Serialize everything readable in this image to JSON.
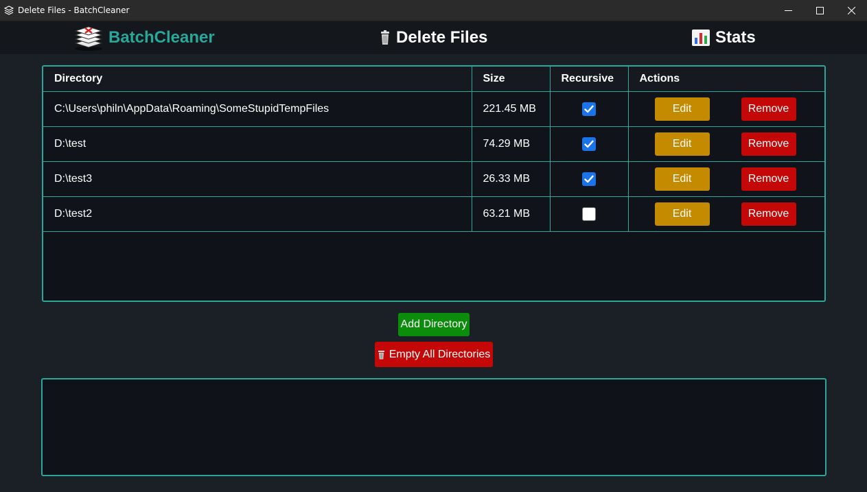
{
  "window": {
    "title": "Delete Files - BatchCleaner"
  },
  "nav": {
    "brand": "BatchCleaner",
    "delete_files": "Delete Files",
    "stats": "Stats"
  },
  "table": {
    "headers": [
      "Directory",
      "Size",
      "Recursive",
      "Actions"
    ],
    "rows": [
      {
        "directory": "C:\\Users\\philn\\AppData\\Roaming\\SomeStupidTempFiles",
        "size": "221.45 MB",
        "recursive": true
      },
      {
        "directory": "D:\\test",
        "size": "74.29 MB",
        "recursive": true
      },
      {
        "directory": "D:\\test3",
        "size": "26.33 MB",
        "recursive": true
      },
      {
        "directory": "D:\\test2",
        "size": "63.21 MB",
        "recursive": false
      }
    ],
    "edit_label": "Edit",
    "remove_label": "Remove"
  },
  "actions": {
    "add_directory": "Add Directory",
    "empty_all": "Empty All Directories"
  },
  "colors": {
    "accent": "#2aa79b",
    "edit": "#c48a00",
    "remove": "#c40707",
    "add": "#0b8c0b",
    "checkbox": "#1a73e8"
  },
  "icons": {
    "window": "stack-icon",
    "brand": "batchcleaner-logo-icon",
    "delete": "trash-icon",
    "stats": "bar-chart-icon",
    "minimize": "minimize-icon",
    "maximize": "maximize-icon",
    "close": "close-icon"
  }
}
